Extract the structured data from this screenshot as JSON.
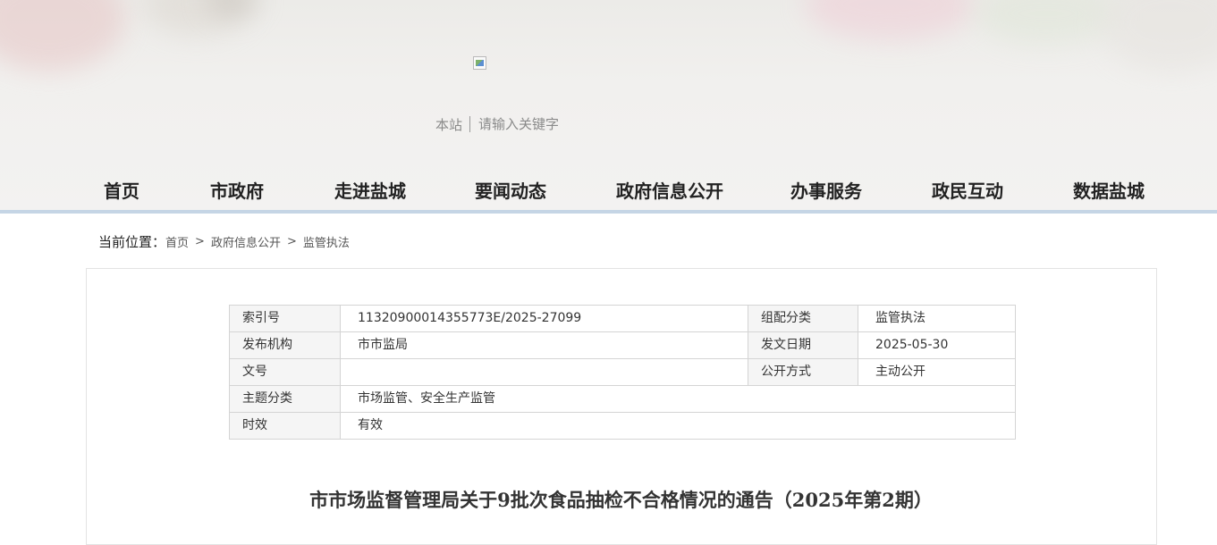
{
  "header": {
    "search": {
      "scope_label": "本站",
      "placeholder": "请输入关键字"
    }
  },
  "nav": {
    "items": [
      {
        "label": "首页"
      },
      {
        "label": "市政府"
      },
      {
        "label": "走进盐城"
      },
      {
        "label": "要闻动态"
      },
      {
        "label": "政府信息公开"
      },
      {
        "label": "办事服务"
      },
      {
        "label": "政民互动"
      },
      {
        "label": "数据盐城"
      }
    ]
  },
  "breadcrumb": {
    "label": "当前位置：",
    "items": [
      "首页",
      "政府信息公开",
      "监管执法"
    ],
    "separator": ">"
  },
  "meta_table": {
    "index_label": "索引号",
    "index_value": "11320900014355773E/2025-27099",
    "category_label": "组配分类",
    "category_value": "监管执法",
    "publisher_label": "发布机构",
    "publisher_value": "市市监局",
    "date_label": "发文日期",
    "date_value": "2025-05-30",
    "doc_no_label": "文号",
    "doc_no_value": "",
    "disclosure_label": "公开方式",
    "disclosure_value": "主动公开",
    "topic_label": "主题分类",
    "topic_value": "市场监管、安全生产监管",
    "validity_label": "时效",
    "validity_value": "有效"
  },
  "article": {
    "title": "市市场监督管理局关于9批次食品抽检不合格情况的通告（2025年第2期）"
  }
}
